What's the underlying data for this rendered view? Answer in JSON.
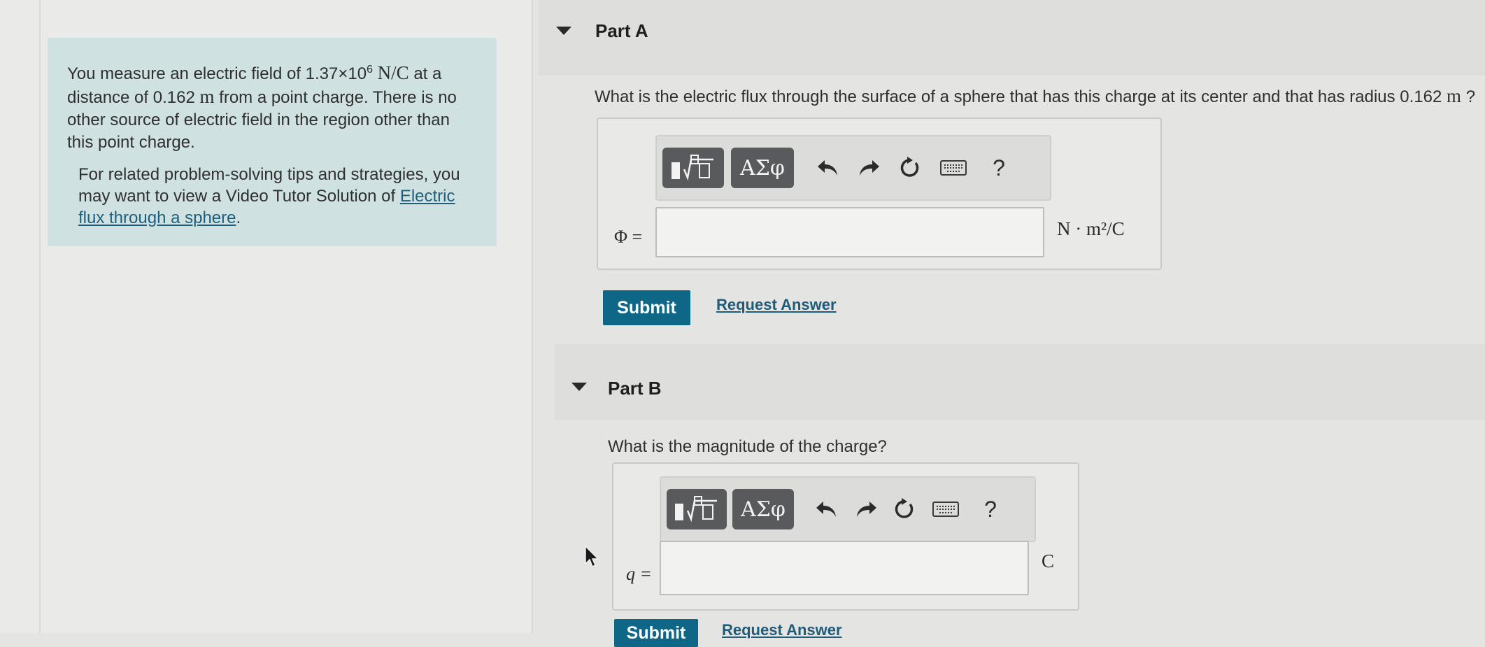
{
  "problem": {
    "intro_pre": "You measure an electric field of 1.37×10",
    "exp": "6",
    "unit_field": "N/C",
    "intro_mid1": " at a distance of 0.162 ",
    "unit_m": "m",
    "intro_post": " from a point charge. There is no other source of electric field in the region other than this point charge.",
    "tips_text": "For related problem-solving tips and strategies, you may want to view a Video Tutor Solution of ",
    "tips_link": "Electric flux through a sphere",
    "tips_end": "."
  },
  "part_a": {
    "title": "Part A",
    "question_pre": "What is the electric flux through the surface of a sphere that has this charge at its center and that has radius 0.162 ",
    "question_unit": "m",
    "question_end": " ?",
    "variable": "Φ =",
    "unit": "N · m²/C",
    "input_value": "",
    "submit_label": "Submit",
    "request_label": "Request Answer"
  },
  "part_b": {
    "title": "Part B",
    "question": "What is the magnitude of the charge?",
    "variable": "q =",
    "unit": "C",
    "input_value": "",
    "submit_label": "Submit",
    "request_label": "Request Answer"
  },
  "toolbar": {
    "greek_label": "ΑΣφ",
    "help_label": "?"
  }
}
